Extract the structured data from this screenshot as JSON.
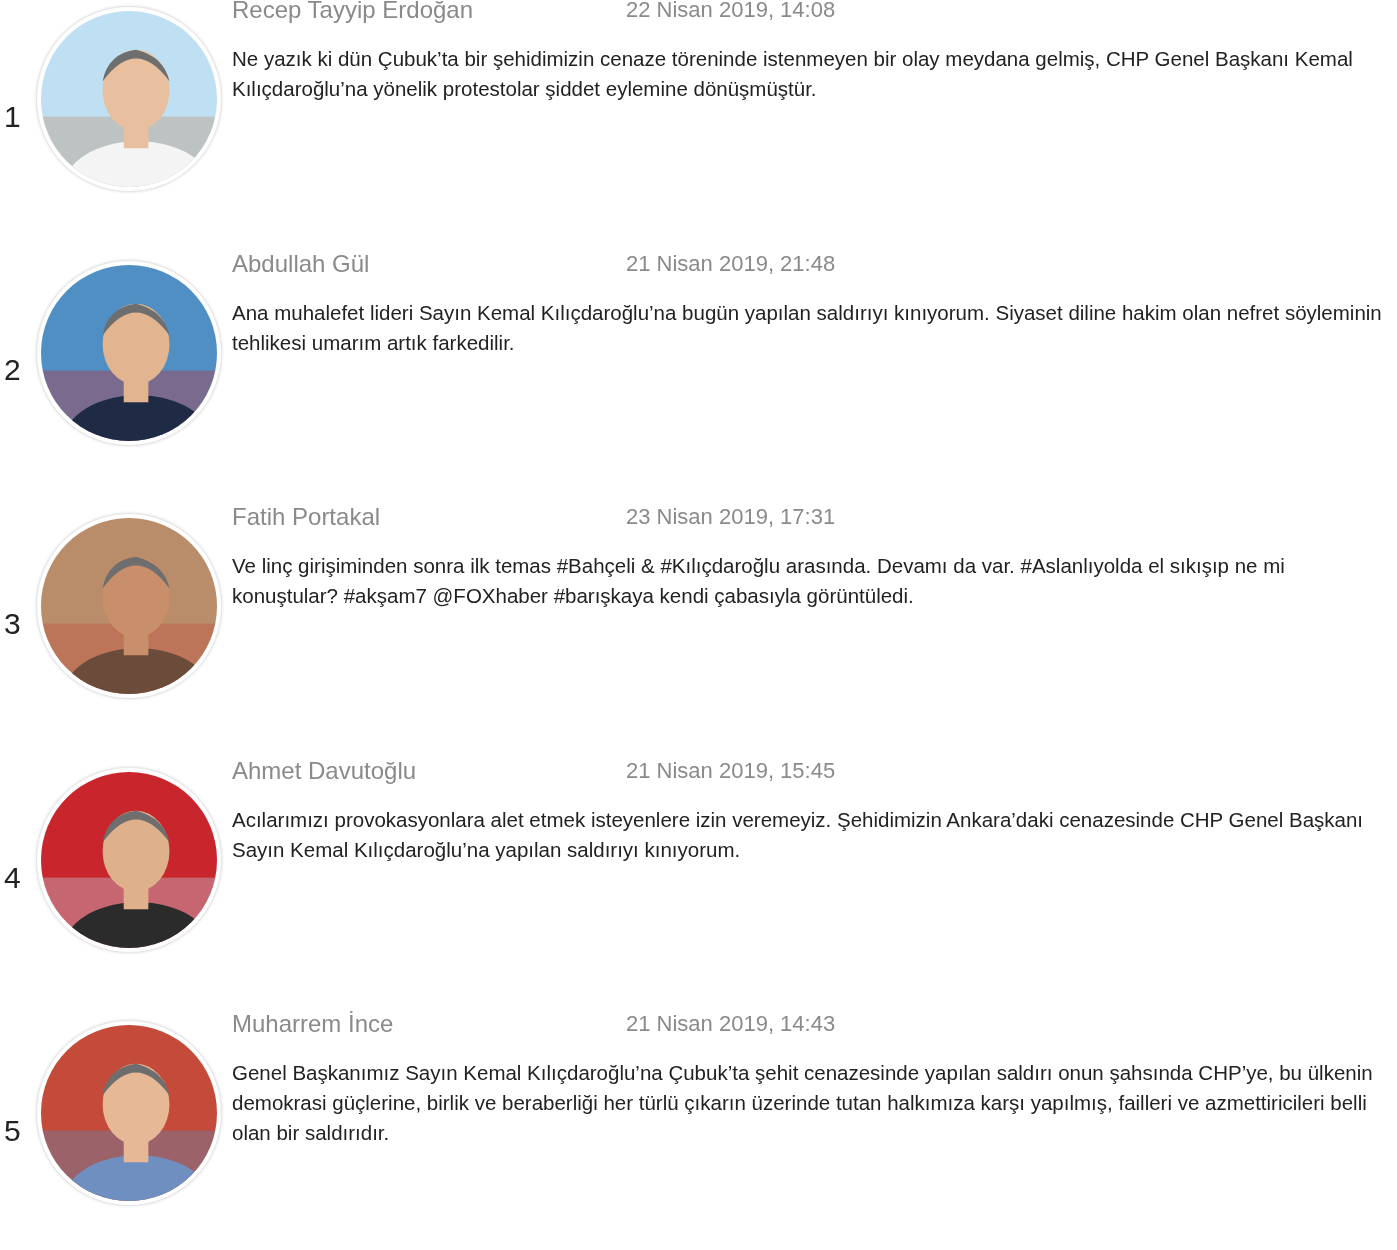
{
  "posts": [
    {
      "number": "1",
      "name": "Recep Tayyip Erdoğan",
      "date": "22 Nisan 2019, 14:08",
      "text": "Ne yazık ki dün Çubuk’ta bir şehidimizin cenaze töreninde istenmeyen bir olay meydana gelmiş, CHP Genel Başkanı Kemal Kılıçdaroğlu’na yönelik protestolar şiddet eylemine dönüşmüştür."
    },
    {
      "number": "2",
      "name": "Abdullah Gül",
      "date": "21 Nisan 2019, 21:48",
      "text": "Ana muhalefet lideri Sayın Kemal Kılıçdaroğlu’na bugün yapılan saldırıyı kınıyorum. Siyaset diline hakim olan nefret söyleminin tehlikesi umarım artık farkedilir."
    },
    {
      "number": "3",
      "name": "Fatih Portakal",
      "date": "23 Nisan 2019, 17:31",
      "text": "Ve linç girişiminden sonra ilk temas #Bahçeli & #Kılıçdaroğlu arasında. Devamı da var. #Aslanlıyolda el sıkışıp ne mi konuştular? #akşam7 @FOXhaber #barışkaya kendi çabasıyla görüntüledi."
    },
    {
      "number": "4",
      "name": "Ahmet Davutoğlu",
      "date": "21 Nisan 2019, 15:45",
      "text": "Acılarımızı provokasyonlara alet etmek isteyenlere izin veremeyiz. Şehidimizin Ankara’daki cenazesinde CHP Genel Başkanı Sayın Kemal Kılıçdaroğlu’na yapılan saldırıyı kınıyorum."
    },
    {
      "number": "5",
      "name": "Muharrem İnce",
      "date": "21 Nisan 2019, 14:43",
      "text": "Genel Başkanımız Sayın Kemal Kılıçdaroğlu’na Çubuk’ta şehit cenazesinde yapılan saldırı onun şahsında CHP’ye, bu ülkenin demokrasi güçlerine, birlik ve beraberliği her türlü çıkarın üzerinde tutan halkımıza karşı yapılmış, failleri ve azmettiricileri belli olan bir saldırıdır."
    }
  ]
}
